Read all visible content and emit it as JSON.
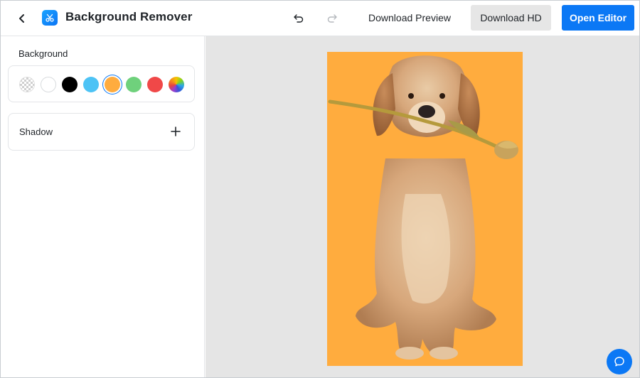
{
  "header": {
    "title": "Background Remover",
    "download_preview_label": "Download Preview",
    "download_hd_label": "Download HD",
    "open_editor_label": "Open Editor"
  },
  "sidebar": {
    "background_label": "Background",
    "swatches": [
      {
        "name": "transparent",
        "color": "transparent",
        "selected": false
      },
      {
        "name": "white",
        "color": "#ffffff",
        "selected": false
      },
      {
        "name": "black",
        "color": "#000000",
        "selected": false
      },
      {
        "name": "light-blue",
        "color": "#4dc3f5",
        "selected": false
      },
      {
        "name": "orange",
        "color": "#ffac3e",
        "selected": true
      },
      {
        "name": "green",
        "color": "#6fd17c",
        "selected": false
      },
      {
        "name": "red",
        "color": "#f04848",
        "selected": false
      },
      {
        "name": "custom-gradient",
        "color": "multicolor",
        "selected": false
      }
    ],
    "shadow_label": "Shadow"
  },
  "canvas": {
    "background_color": "#ffac3e",
    "subject": "golden retriever puppy holding a tulip in mouth"
  },
  "colors": {
    "accent": "#0b78f5",
    "canvas_bg": "#e5e5e5"
  }
}
